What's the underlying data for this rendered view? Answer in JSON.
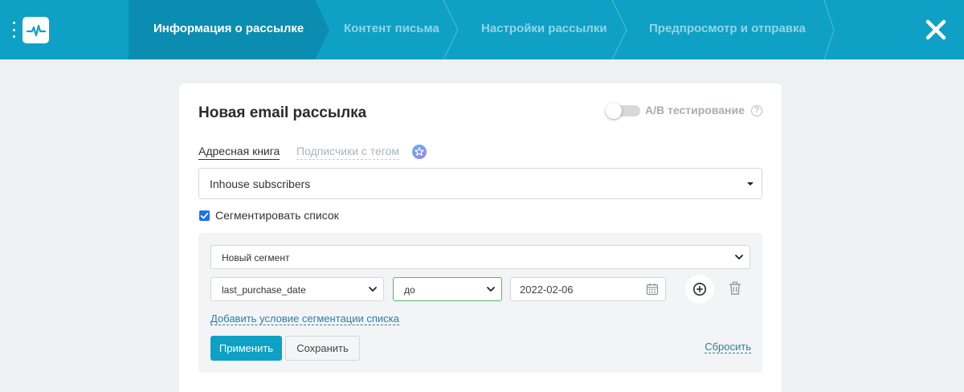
{
  "header": {
    "menu_icon": "vertical-dots-icon",
    "logo_icon": "pulse-icon",
    "steps": [
      {
        "label": "Информация о рассылке",
        "active": true
      },
      {
        "label": "Контент письма",
        "active": false
      },
      {
        "label": "Настройки рассылки",
        "active": false
      },
      {
        "label": "Предпросмотр и отправка",
        "active": false
      }
    ],
    "close_icon": "close-icon"
  },
  "colors": {
    "primary": "#0ea1c5",
    "link": "#2e7ea8",
    "focus_border": "#4cc05a",
    "checkbox": "#1a73e8"
  },
  "form": {
    "title": "Новая email рассылка",
    "ab_testing": {
      "label": "A/B тестирование",
      "enabled": false,
      "help_icon": "question-icon",
      "help_glyph": "?"
    },
    "source_tabs": [
      {
        "label": "Адресная книга",
        "active": true
      },
      {
        "label": "Подписчики с тегом",
        "active": false,
        "icon": "star-badge-icon"
      }
    ],
    "address_book": {
      "value": "Inhouse subscribers"
    },
    "segment_checkbox": {
      "label": "Сегментировать список",
      "checked": true
    },
    "segment": {
      "segment_select": {
        "value": "Новый сегмент"
      },
      "condition": {
        "field": "last_purchase_date",
        "operator": "до",
        "date": "2022-02-06"
      },
      "add_condition_link": "Добавить условие сегментации списка",
      "apply_label": "Применить",
      "save_label": "Сохранить",
      "reset_label": "Сбросить"
    }
  }
}
